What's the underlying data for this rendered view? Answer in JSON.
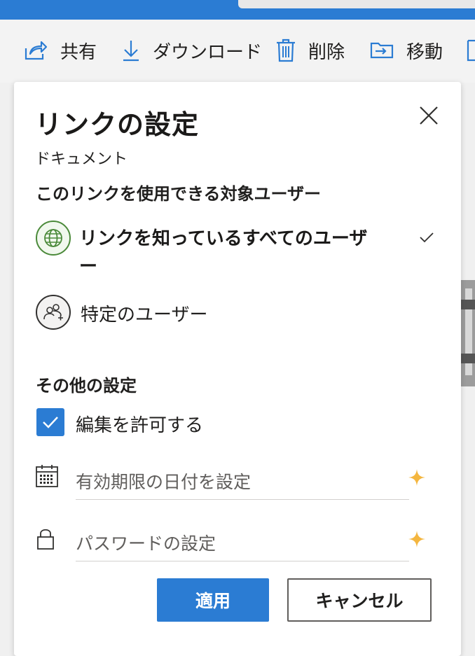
{
  "command_bar": {
    "share_label": "共有",
    "download_label": "ダウンロード",
    "delete_label": "削除",
    "move_label": "移動"
  },
  "dialog": {
    "title": "リンクの設定",
    "subtitle": "ドキュメント",
    "audience_heading": "このリンクを使用できる対象ユーザー",
    "audience_options": [
      {
        "label": "リンクを知っているすべてのユーザー",
        "icon": "globe-icon",
        "selected": true
      },
      {
        "label": "特定のユーザー",
        "icon": "people-add-icon",
        "selected": false
      }
    ],
    "other_settings_heading": "その他の設定",
    "allow_edit_label": "編集を許可する",
    "allow_edit_checked": true,
    "expiry_placeholder": "有効期限の日付を設定",
    "password_placeholder": "パスワードの設定",
    "apply_label": "適用",
    "cancel_label": "キャンセル"
  },
  "colors": {
    "accent": "#2b7cd3",
    "globe_green": "#4b8a3a",
    "sparkle": "#f4b63f"
  }
}
